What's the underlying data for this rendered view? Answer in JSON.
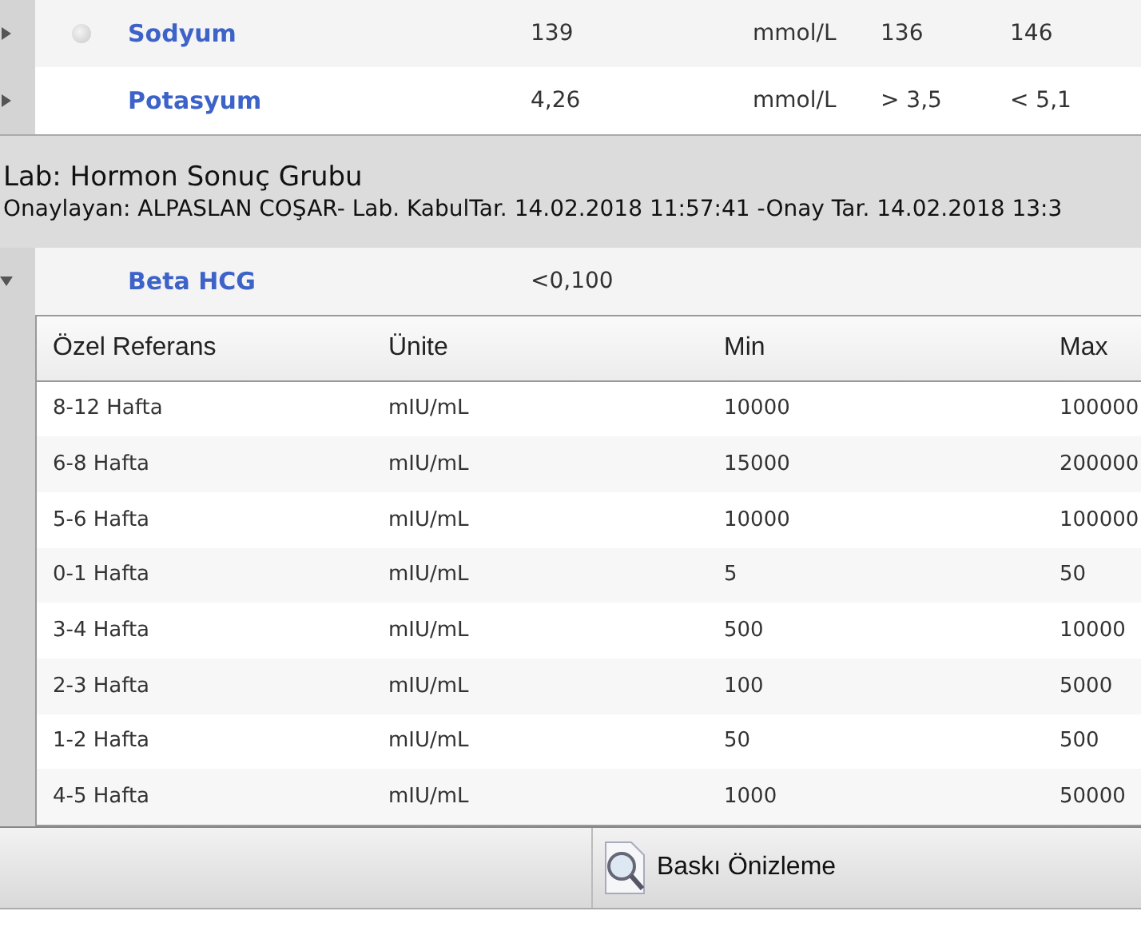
{
  "results": [
    {
      "test": "Sodyum",
      "value": "139",
      "unit": "mmol/L",
      "min": "136",
      "max": "146",
      "expanded": false,
      "marked": true
    },
    {
      "test": "Potasyum",
      "value": "4,26",
      "unit": "mmol/L",
      "min": "> 3,5",
      "max": "< 5,1",
      "expanded": false,
      "marked": false
    }
  ],
  "lab_group": {
    "title": "Lab: Hormon Sonuç Grubu",
    "approval": "Onaylayan: ALPASLAN COŞAR- Lab. KabulTar. 14.02.2018 11:57:41 -Onay Tar. 14.02.2018 13:3"
  },
  "group_results": [
    {
      "test": "Beta HCG",
      "value": "<0,100",
      "expanded": true,
      "marked": false
    }
  ],
  "reference_table": {
    "columns": [
      "Özel Referans",
      "Ünite",
      "Min",
      "Max"
    ],
    "rows": [
      [
        "8-12 Hafta",
        "mIU/mL",
        "10000",
        "100000"
      ],
      [
        "6-8 Hafta",
        "mIU/mL",
        "15000",
        "200000"
      ],
      [
        "5-6 Hafta",
        "mIU/mL",
        "10000",
        "100000"
      ],
      [
        "0-1 Hafta",
        "mIU/mL",
        "5",
        "50"
      ],
      [
        "3-4 Hafta",
        "mIU/mL",
        "500",
        "10000"
      ],
      [
        "2-3 Hafta",
        "mIU/mL",
        "100",
        "5000"
      ],
      [
        "1-2 Hafta",
        "mIU/mL",
        "50",
        "500"
      ],
      [
        "4-5 Hafta",
        "mIU/mL",
        "1000",
        "50000"
      ]
    ]
  },
  "toolbar": {
    "buttons": [
      "Baskı Önizleme"
    ]
  }
}
